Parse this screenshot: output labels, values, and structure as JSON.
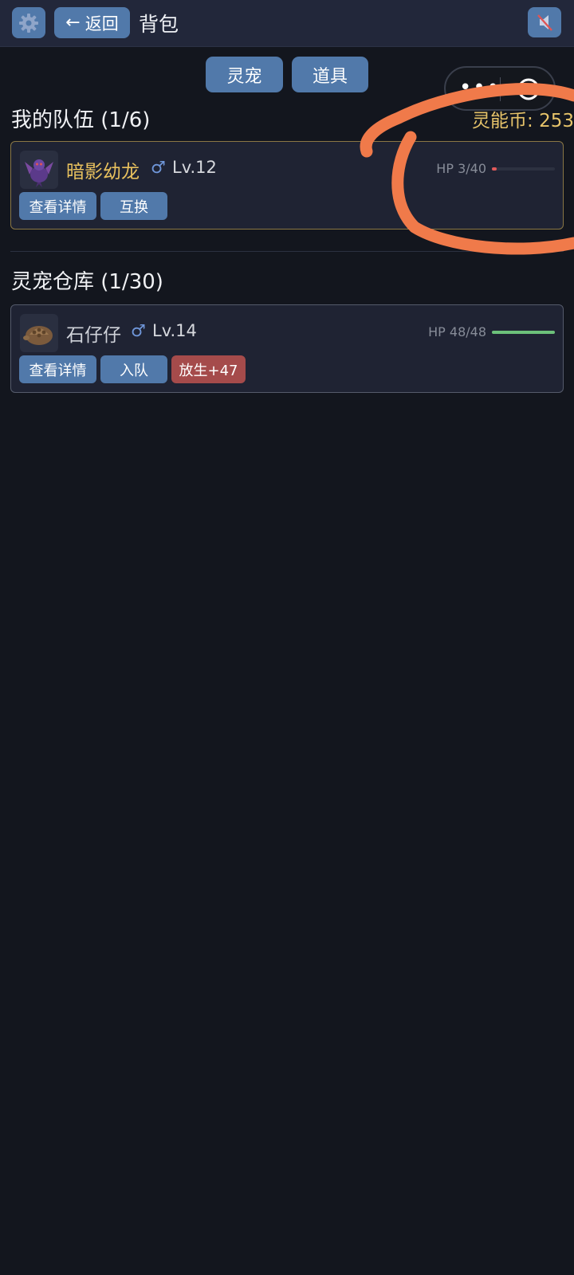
{
  "header": {
    "back_label": "返回",
    "back_arrow": "←",
    "title": "背包",
    "settings_icon": "gear-icon",
    "mute_icon": "speaker-muted-icon"
  },
  "tabs": [
    {
      "label": "灵宠",
      "active": true
    },
    {
      "label": "道具",
      "active": false
    }
  ],
  "mini_program_capsule": {
    "menu_icon": "more-dots-icon",
    "close_icon": "target-close-icon"
  },
  "team": {
    "title": "我的队伍 (1/6)",
    "coins_label": "灵能币: 253",
    "pets": [
      {
        "name": "暗影幼龙",
        "name_color": "#e8c15e",
        "gender": "♂",
        "level": "Lv.12",
        "hp_text": "HP 3/40",
        "hp_fraction": 0.075,
        "hp_color": "#e05a5a",
        "avatar_icon": "purple-dragon-icon",
        "actions": [
          {
            "label": "查看详情",
            "type": "primary"
          },
          {
            "label": "互换",
            "type": "primary"
          }
        ]
      }
    ]
  },
  "storage": {
    "title": "灵宠仓库 (1/30)",
    "pets": [
      {
        "name": "石仔仔",
        "name_color": "#cfd2d9",
        "gender": "♂",
        "level": "Lv.14",
        "hp_text": "HP 48/48",
        "hp_fraction": 1.0,
        "hp_color": "#6cc17a",
        "avatar_icon": "rock-tortoise-icon",
        "actions": [
          {
            "label": "查看详情",
            "type": "primary"
          },
          {
            "label": "入队",
            "type": "primary"
          },
          {
            "label": "放生+47",
            "type": "danger"
          }
        ]
      }
    ]
  },
  "colors": {
    "background": "#13161e",
    "topbar": "#22273a",
    "button_blue": "#5179aa",
    "release_red": "#a54b4b",
    "coin_gold": "#e7c46a",
    "annotation_orange": "#f07a4a"
  }
}
